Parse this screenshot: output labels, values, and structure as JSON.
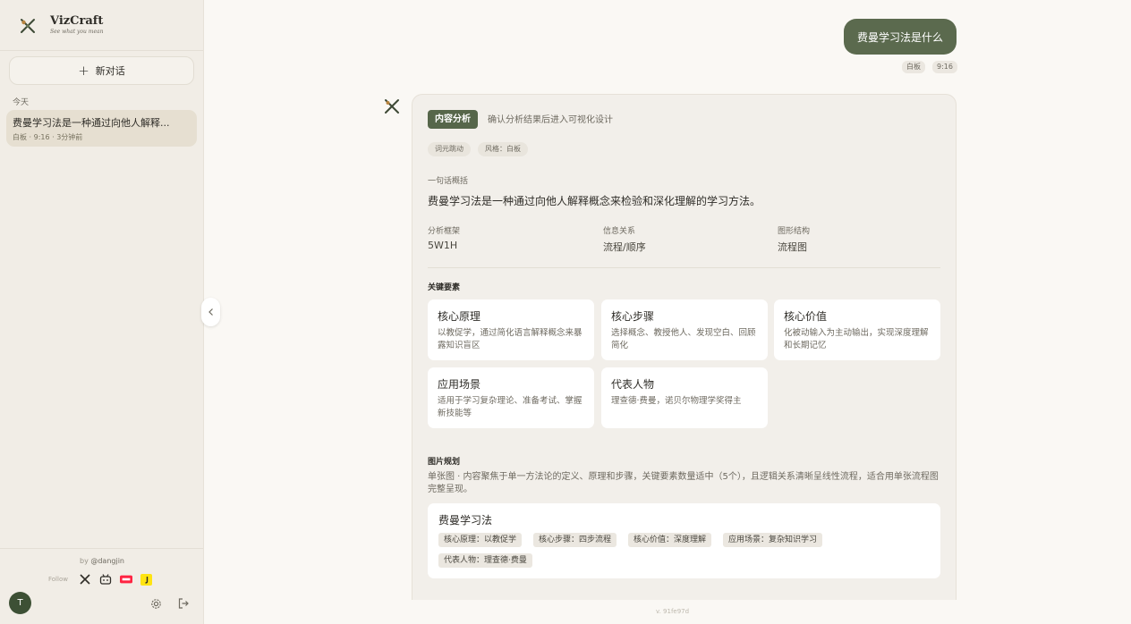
{
  "brand": {
    "name": "VizCraft",
    "tagline": "See what you mean"
  },
  "sidebar": {
    "new_chat_label": "新对话",
    "section_label": "今天",
    "chats": [
      {
        "title": "费曼学习法是一种通过向他人解释...",
        "meta": "白板 · 9:16 · 3分钟前"
      }
    ],
    "by_prefix": "by",
    "by_handle": "@dangjin",
    "follow_label": "Follow",
    "avatar_letter": "T"
  },
  "message": {
    "user_text": "费曼学习法是什么",
    "mode_chip": "白板",
    "time_chip": "9:16"
  },
  "analysis": {
    "badge": "内容分析",
    "subtitle": "确认分析结果后进入可视化设计",
    "tags": [
      "词元跳动",
      "风格：白板"
    ],
    "summary_label": "一句话概括",
    "summary": "费曼学习法是一种通过向他人解释概念来检验和深化理解的学习方法。",
    "meta": [
      {
        "label": "分析框架",
        "value": "5W1H"
      },
      {
        "label": "信息关系",
        "value": "流程/顺序"
      },
      {
        "label": "图形结构",
        "value": "流程图"
      }
    ],
    "key_title": "关键要素",
    "key_items": [
      {
        "title": "核心原理",
        "desc": "以教促学，通过简化语言解释概念来暴露知识盲区"
      },
      {
        "title": "核心步骤",
        "desc": "选择概念、教授他人、发现空白、回顾简化"
      },
      {
        "title": "核心价值",
        "desc": "化被动输入为主动输出，实现深度理解和长期记忆"
      },
      {
        "title": "应用场景",
        "desc": "适用于学习复杂理论、准备考试、掌握新技能等"
      },
      {
        "title": "代表人物",
        "desc": "理查德·费曼，诺贝尔物理学奖得主"
      }
    ],
    "plan_title": "图片规划",
    "plan_desc": "单张图 · 内容聚焦于单一方法论的定义、原理和步骤，关键要素数量适中（5个），且逻辑关系清晰呈线性流程，适合用单张流程图完整呈现。",
    "plan_card_title": "费曼学习法",
    "plan_chips": [
      "核心原理：以教促学",
      "核心步骤：四步流程",
      "核心价值：深度理解",
      "应用场景：复杂知识学习",
      "代表人物：理查德·费曼"
    ]
  },
  "footer": {
    "version": "v. 91fe97d"
  }
}
